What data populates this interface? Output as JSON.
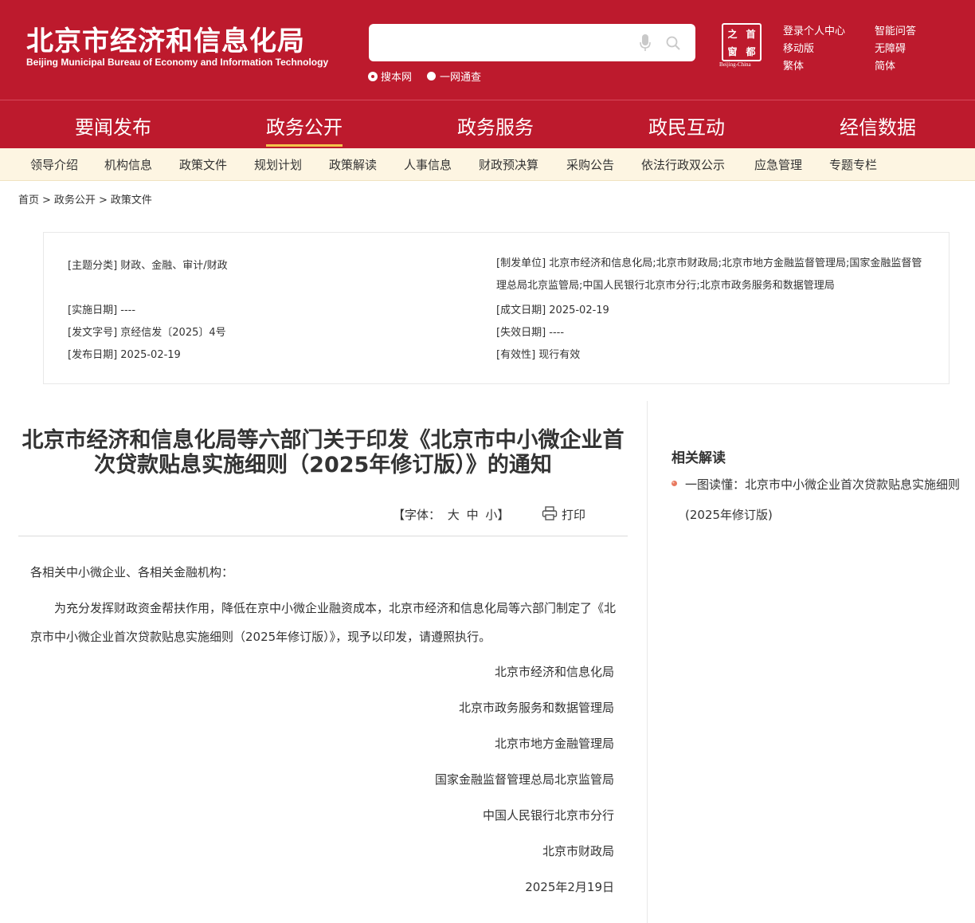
{
  "header": {
    "logo_cn": "北京市经济和信息化局",
    "logo_en": "Beijing Municipal Bureau of Economy and Information Technology",
    "search": {
      "placeholder": ""
    },
    "search_scope": [
      {
        "label": "搜本网",
        "selected": true
      },
      {
        "label": "一网通查",
        "selected": false
      }
    ],
    "seal": {
      "chars": [
        "之",
        "首",
        "窗",
        "都"
      ],
      "caption": "Beijing-China"
    },
    "links": [
      "登录个人中心",
      "智能问答",
      "移动版",
      "无障碍",
      "繁体",
      "简体"
    ]
  },
  "main_nav": {
    "items": [
      "要闻发布",
      "政务公开",
      "政务服务",
      "政民互动",
      "经信数据"
    ],
    "active": "政务公开"
  },
  "sub_nav": {
    "items": [
      "领导介绍",
      "机构信息",
      "政策文件",
      "规划计划",
      "政策解读",
      "人事信息",
      "财政预决算",
      "采购公告",
      "依法行政双公示",
      "应急管理",
      "专题专栏"
    ]
  },
  "breadcrumb": {
    "items": [
      "首页",
      "政务公开",
      "政策文件"
    ],
    "separator": ">"
  },
  "metadata": {
    "topic": "[主题分类] 财政、金融、审计/财政",
    "issuer": "[制发单位] 北京市经济和信息化局;北京市财政局;北京市地方金融监督管理局;国家金融监督管理总局北京监管局;中国人民银行北京市分行;北京市政务服务和数据管理局",
    "effective_date": "[实施日期] ----",
    "written_date": "[成文日期] 2025-02-19",
    "doc_number": "[发文字号] 京经信发〔2025〕4号",
    "expiry_date": "[失效日期] ----",
    "publish_date": "[发布日期] 2025-02-19",
    "validity": "[有效性] 现行有效"
  },
  "article": {
    "title": "北京市经济和信息化局等六部门关于印发《北京市中小微企业首次贷款贴息实施细则（2025年修订版）》的通知",
    "font_label": "【字体：",
    "font_sizes": [
      "大",
      "中",
      "小"
    ],
    "font_close": "】",
    "print_label": "打印",
    "salutation": "各相关中小微企业、各相关金融机构：",
    "paragraph": "为充分发挥财政资金帮扶作用，降低在京中小微企业融资成本，北京市经济和信息化局等六部门制定了《北京市中小微企业首次贷款贴息实施细则（2025年修订版）》，现予以印发，请遵照执行。",
    "signatories": [
      "北京市经济和信息化局",
      "北京市政务服务和数据管理局",
      "北京市地方金融管理局",
      "国家金融监督管理总局北京监管局",
      "中国人民银行北京市分行",
      "北京市财政局"
    ],
    "date": "2025年2月19日"
  },
  "sidebar": {
    "title": "相关解读",
    "items": [
      "一图读懂：北京市中小微企业首次贷款贴息实施细则(2025年修订版)"
    ]
  },
  "colors": {
    "brand_red": "#bd1a2d",
    "subnav_bg": "#fdf5e2",
    "active_underline": "#f3c54a"
  }
}
